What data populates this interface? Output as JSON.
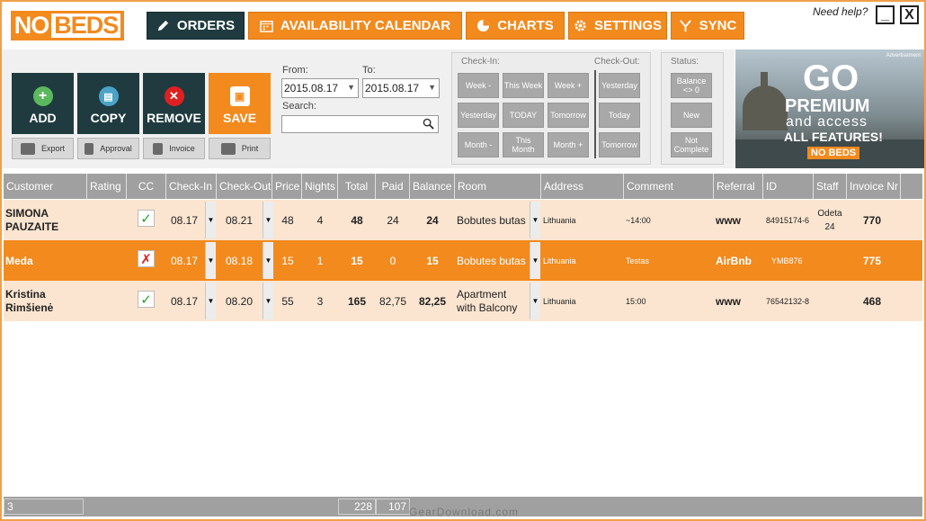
{
  "app": {
    "logo_no": "NO",
    "logo_beds": "BEDS",
    "help": "Need help?",
    "minimize": "_",
    "close": "X"
  },
  "nav": {
    "orders": "ORDERS",
    "calendar": "AVAILABILITY CALENDAR",
    "charts": "CHARTS",
    "settings": "SETTINGS",
    "sync": "SYNC"
  },
  "toolbar": {
    "add": "ADD",
    "copy": "COPY",
    "remove": "REMOVE",
    "save": "SAVE",
    "export": "Export",
    "approval": "Approval",
    "invoice": "Invoice",
    "print": "Print"
  },
  "filters": {
    "from_label": "From:",
    "to_label": "To:",
    "from": "2015.08.17",
    "to": "2015.08.17",
    "search_label": "Search:",
    "search_value": ""
  },
  "checkin": {
    "label": "Check-In:",
    "buttons": [
      "Week -",
      "This Week",
      "Week +",
      "Yesterday",
      "TODAY",
      "Tomorrow",
      "Month -",
      "This Month",
      "Month +"
    ]
  },
  "checkout": {
    "label": "Check-Out:",
    "buttons": [
      "Yesterday",
      "Today",
      "Tomorrow"
    ]
  },
  "status": {
    "label": "Status:",
    "buttons": [
      "Balance <> 0",
      "New",
      "Not Complete"
    ]
  },
  "ad": {
    "tag": "Advertisement",
    "go": "GO",
    "premium": "PREMIUM",
    "access": "and access",
    "features": "ALL FEATURES!",
    "logo": "NO BEDS"
  },
  "columns": [
    "Customer",
    "Rating",
    "CC",
    "Check-In",
    "Check-Out",
    "Price",
    "Nights",
    "Total",
    "Paid",
    "Balance",
    "Room",
    "Address",
    "Comment",
    "Referral",
    "ID",
    "Staff",
    "Invoice Nr"
  ],
  "rows": [
    {
      "customer": "SIMONA PAUZAITE",
      "cc": "✓",
      "checkin": "08.17",
      "checkout": "08.21",
      "price": "48",
      "nights": "4",
      "total": "48",
      "paid": "24",
      "balance": "24",
      "room": "Bobutes butas",
      "address": "Lithuania",
      "comment": "~14:00",
      "referral": "www",
      "id": "84915174-6",
      "staff": "Odeta 24",
      "invoice": "770"
    },
    {
      "customer": "Meda",
      "cc": "✗",
      "checkin": "08.17",
      "checkout": "08.18",
      "price": "15",
      "nights": "1",
      "total": "15",
      "paid": "0",
      "balance": "15",
      "room": "Bobutes butas",
      "address": "Lithuania",
      "comment": "Testas",
      "referral": "AirBnb",
      "id": "YMB876",
      "staff": "",
      "invoice": "775"
    },
    {
      "customer": "Kristina Rimšienė",
      "cc": "✓",
      "checkin": "08.17",
      "checkout": "08.20",
      "price": "55",
      "nights": "3",
      "total": "165",
      "paid": "82,75",
      "balance": "82,25",
      "room": "Apartment with Balcony",
      "address": "Lithuania",
      "comment": "15:00",
      "referral": "www",
      "id": "76542132-8",
      "staff": "",
      "invoice": "468"
    }
  ],
  "footer": {
    "count": "3",
    "total": "228",
    "paid": "107"
  },
  "watermark": "GearDownload.com",
  "colors": {
    "accent": "#f28a1e",
    "dark": "#1f3b3f",
    "header_gray": "#a0a0a0",
    "row_bg": "#fbe5d0"
  }
}
